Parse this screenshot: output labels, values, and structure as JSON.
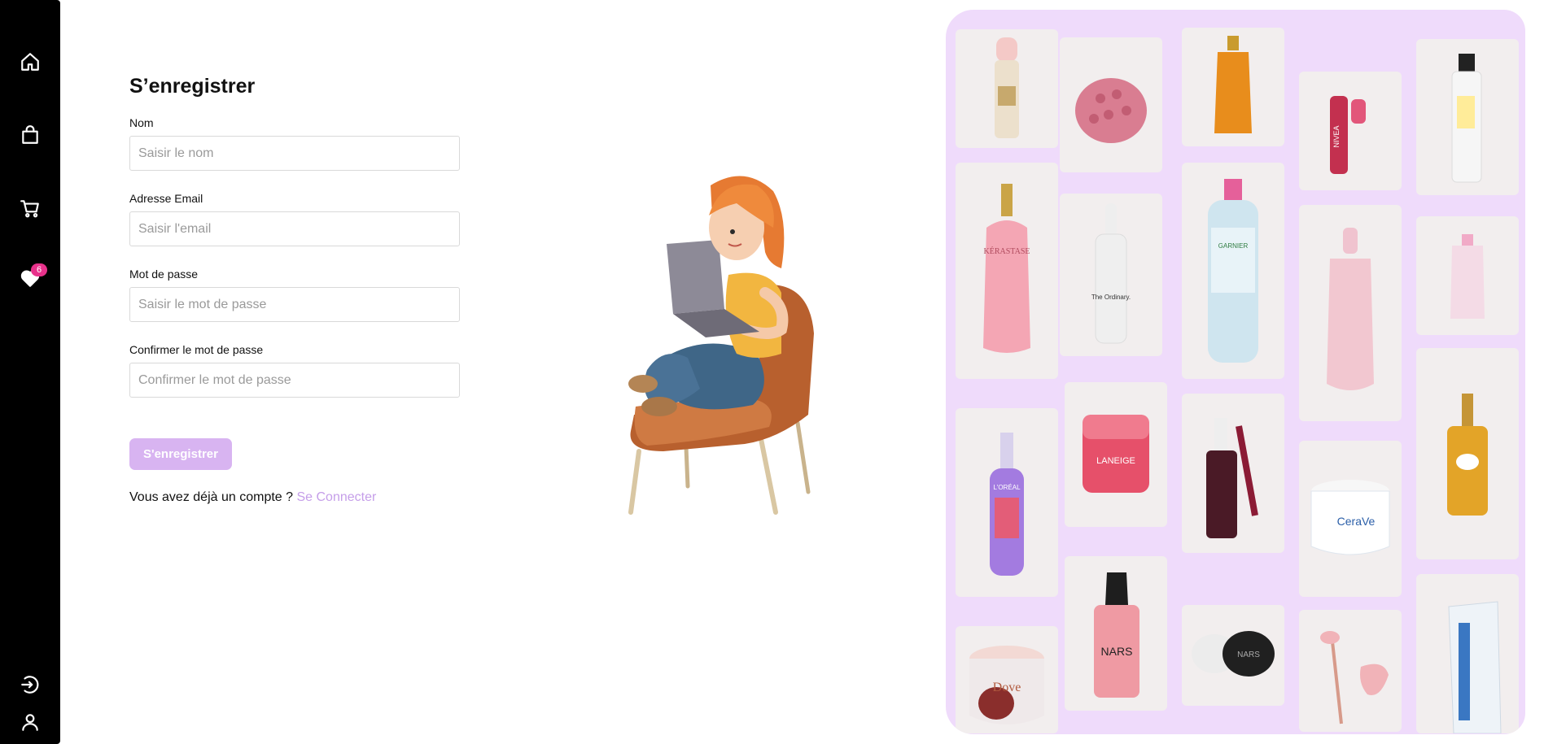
{
  "sidebar": {
    "items": [
      {
        "name": "home",
        "icon": "home-icon"
      },
      {
        "name": "shop",
        "icon": "shopping-bag-icon"
      },
      {
        "name": "cart",
        "icon": "cart-icon"
      },
      {
        "name": "favorites",
        "icon": "heart-icon",
        "badge": "6"
      },
      {
        "name": "login",
        "icon": "login-icon"
      },
      {
        "name": "account",
        "icon": "user-icon"
      }
    ],
    "badge_color": "#e8328b"
  },
  "form": {
    "title": "S’enregistrer",
    "name_label": "Nom",
    "name_placeholder": "Saisir le nom",
    "email_label": "Adresse Email",
    "email_placeholder": "Saisir l'email",
    "password_label": "Mot de passe",
    "password_placeholder": "Saisir le mot de passe",
    "confirm_label": "Confirmer le mot de passe",
    "confirm_placeholder": "Confirmer le mot de passe",
    "submit_label": "S'enregistrer",
    "have_account_text": "Vous avez déjà un compte ?",
    "login_link": "Se Connecter"
  },
  "colors": {
    "accent": "#d8b4f1",
    "link": "#c59ee9",
    "mosaic_bg": "#efdbfb",
    "tile_bg": "#f2eeee"
  },
  "products": {
    "brand_nivea": "NIVEA",
    "brand_laneige": "LANEIGE",
    "brand_cerave": "CeraVe",
    "brand_nars": "NARS",
    "brand_dove": "Dove",
    "brand_kerastase": "KÉRASTASE",
    "brand_garnier": "GARNIER",
    "brand_loreal": "L'ORÉAL",
    "brand_ordinary": "The Ordinary."
  }
}
